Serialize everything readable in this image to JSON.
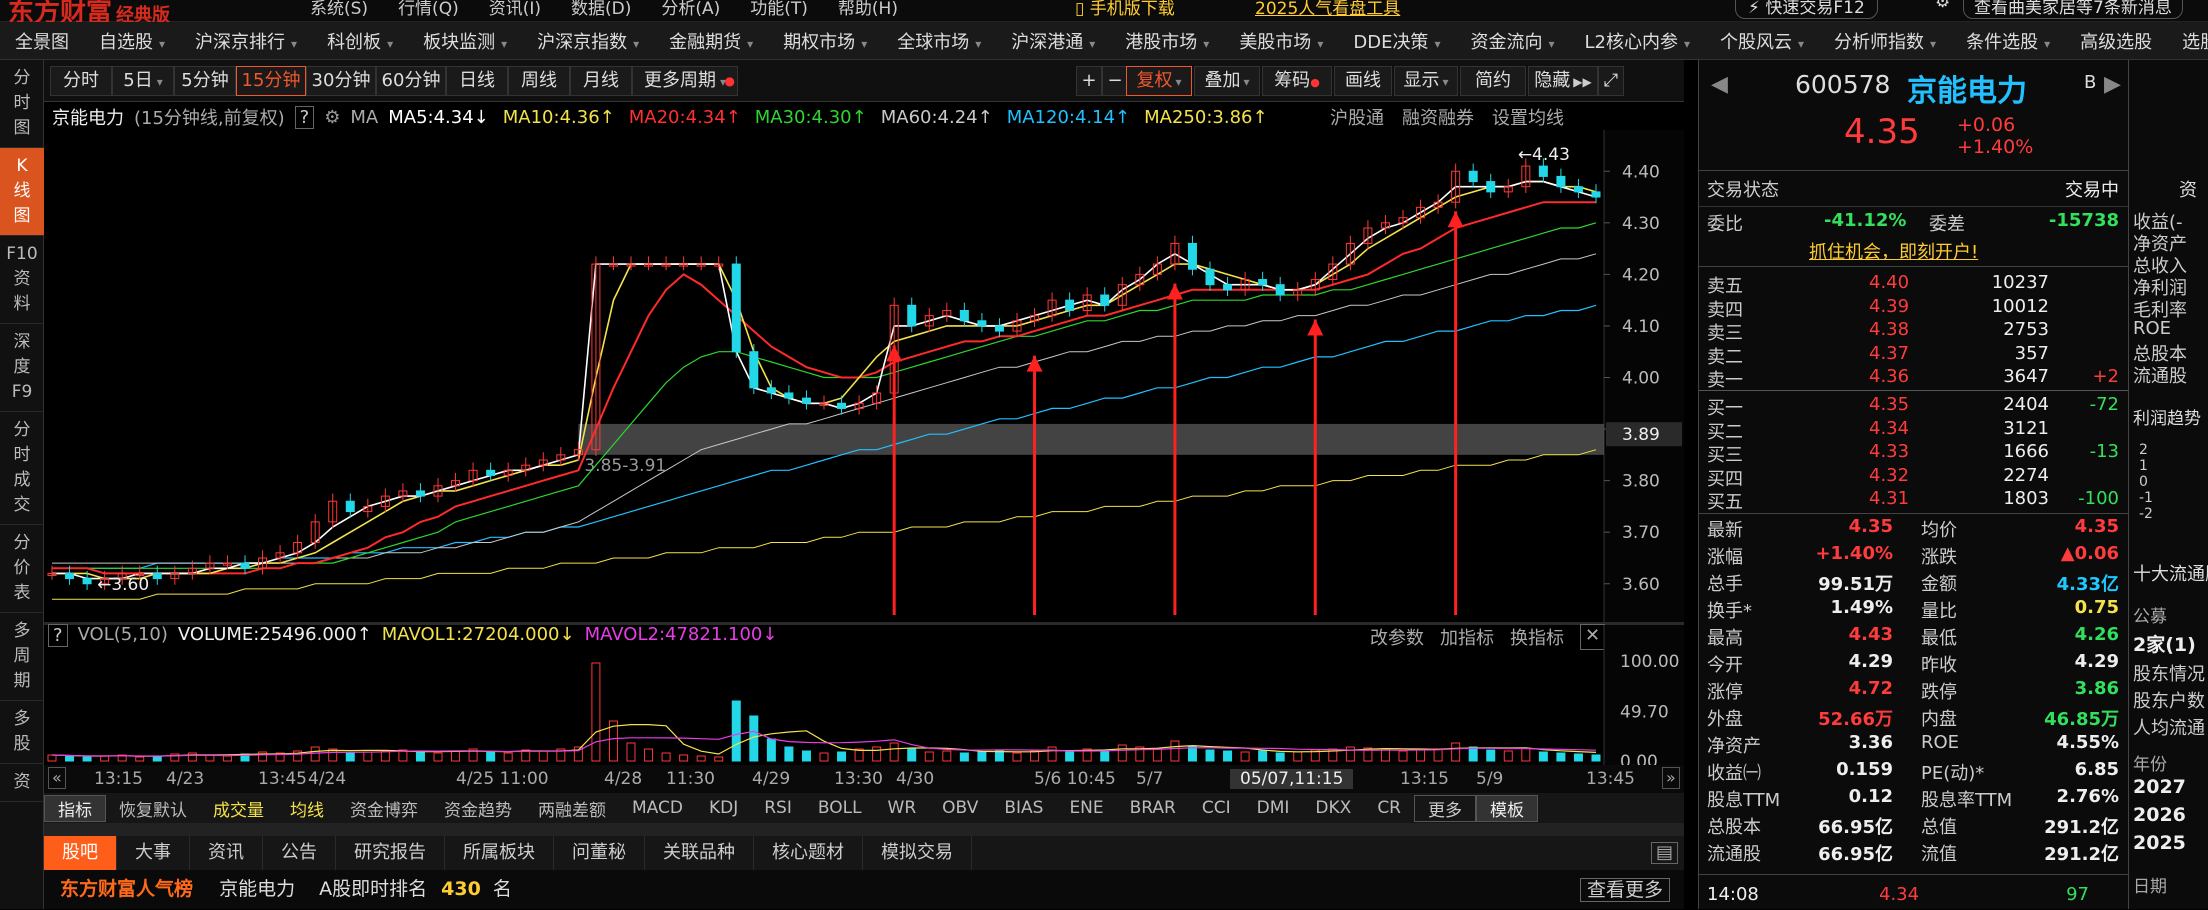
{
  "top": {
    "logo": "东方财富",
    "edition": "经典版",
    "menus": [
      "系统(S)",
      "行情(Q)",
      "资讯(I)",
      "数据(D)",
      "分析(A)",
      "功能(T)",
      "帮助(H)"
    ],
    "mobile": "手机版下载",
    "promo": "2025人气看盘工具",
    "quick_trade": "快速交易F12",
    "notice": "查看曲美家居等7条新消息"
  },
  "nav": [
    "全景图",
    "自选股",
    "沪深京排行",
    "科创板",
    "板块监测",
    "沪深京指数",
    "金融期货",
    "期权市场",
    "全球市场",
    "沪深港通",
    "港股市场",
    "美股市场",
    "DDE决策",
    "资金流向",
    "L2核心内参",
    "个股风云",
    "分析师指数",
    "条件选股",
    "高级选股",
    "选股器"
  ],
  "left_tabs": [
    {
      "label": "分\n时\n图"
    },
    {
      "label": "K\n线\n图",
      "active": true
    },
    {
      "label": "F10\n资\n料"
    },
    {
      "label": "深\n度\nF9"
    },
    {
      "label": "分\n时\n成\n交"
    },
    {
      "label": "分\n价\n表"
    },
    {
      "label": "多\n周\n期"
    },
    {
      "label": "多\n股"
    },
    {
      "label": "资"
    }
  ],
  "periods": [
    "分时",
    "5日",
    "5分钟",
    "15分钟",
    "30分钟",
    "60分钟",
    "日线",
    "周线",
    "月线",
    "更多周期"
  ],
  "active_period": "15分钟",
  "tools": [
    "+",
    "−",
    "复权",
    "叠加",
    "筹码",
    "画线",
    "显示",
    "简约",
    "隐藏"
  ],
  "chart_header": {
    "name": "京能电力",
    "desc": "(15分钟线,前复权)",
    "help": "?",
    "ma_label": "MA",
    "right_links": [
      "沪股通",
      "融资融券",
      "设置均线"
    ]
  },
  "ma_items": [
    {
      "text": "MA5:4.34",
      "arrow": "↓",
      "color": "#ffffff"
    },
    {
      "text": "MA10:4.36",
      "arrow": "↑",
      "color": "#f3e24a"
    },
    {
      "text": "MA20:4.34",
      "arrow": "↑",
      "color": "#ff3030"
    },
    {
      "text": "MA30:4.30",
      "arrow": "↑",
      "color": "#2fd52f"
    },
    {
      "text": "MA60:4.24",
      "arrow": "↑",
      "color": "#c8c8c8"
    },
    {
      "text": "MA120:4.14",
      "arrow": "↑",
      "color": "#23c0ff"
    },
    {
      "text": "MA250:3.86",
      "arrow": "↑",
      "color": "#f3e24a"
    }
  ],
  "chart_data": {
    "type": "line",
    "y_ticks": [
      "4.40",
      "4.30",
      "4.20",
      "4.10",
      "4.00",
      "3.90",
      "3.80",
      "3.70",
      "3.60"
    ],
    "ylim": [
      3.52,
      4.48
    ],
    "current_price_label": "3.89",
    "high_mark": "4.43",
    "low_mark": "3.60",
    "band_label": "3.85-3.91",
    "band": [
      3.85,
      3.91
    ],
    "dates": [
      "13:15",
      "4/23",
      "13:45",
      "4/24",
      "4/25 11:00",
      "4/28",
      "11:30",
      "4/29",
      "13:30",
      "4/30",
      "5/6 10:45",
      "5/7",
      "05/07,11:15",
      "13:15",
      "5/9",
      "13:45"
    ],
    "close": [
      3.62,
      3.61,
      3.6,
      3.61,
      3.62,
      3.62,
      3.61,
      3.62,
      3.63,
      3.64,
      3.64,
      3.63,
      3.65,
      3.66,
      3.68,
      3.72,
      3.76,
      3.74,
      3.75,
      3.77,
      3.78,
      3.77,
      3.79,
      3.8,
      3.82,
      3.81,
      3.82,
      3.83,
      3.84,
      3.85,
      3.86,
      4.22,
      4.22,
      4.22,
      4.22,
      4.22,
      4.22,
      4.22,
      4.22,
      4.05,
      3.98,
      3.97,
      3.96,
      3.95,
      3.95,
      3.94,
      3.95,
      3.97,
      4.14,
      4.1,
      4.12,
      4.13,
      4.11,
      4.1,
      4.09,
      4.11,
      4.12,
      4.15,
      4.13,
      4.16,
      4.14,
      4.18,
      4.2,
      4.22,
      4.26,
      4.21,
      4.18,
      4.17,
      4.19,
      4.18,
      4.16,
      4.17,
      4.19,
      4.22,
      4.26,
      4.29,
      4.3,
      4.31,
      4.33,
      4.34,
      4.4,
      4.38,
      4.36,
      4.37,
      4.41,
      4.39,
      4.37,
      4.36,
      4.35
    ],
    "ma5": [
      3.62,
      3.62,
      3.61,
      3.61,
      3.61,
      3.62,
      3.62,
      3.62,
      3.62,
      3.63,
      3.63,
      3.64,
      3.64,
      3.65,
      3.66,
      3.68,
      3.71,
      3.73,
      3.75,
      3.76,
      3.77,
      3.77,
      3.78,
      3.79,
      3.8,
      3.81,
      3.82,
      3.82,
      3.83,
      3.84,
      3.85,
      4.22,
      4.22,
      4.22,
      4.22,
      4.22,
      4.22,
      4.22,
      4.22,
      4.05,
      3.98,
      3.97,
      3.96,
      3.95,
      3.95,
      3.94,
      3.95,
      3.97,
      4.1,
      4.1,
      4.11,
      4.12,
      4.11,
      4.1,
      4.1,
      4.11,
      4.12,
      4.13,
      4.14,
      4.15,
      4.14,
      4.17,
      4.19,
      4.22,
      4.24,
      4.22,
      4.2,
      4.18,
      4.18,
      4.18,
      4.17,
      4.17,
      4.18,
      4.21,
      4.24,
      4.27,
      4.29,
      4.3,
      4.32,
      4.34,
      4.37,
      4.37,
      4.37,
      4.37,
      4.38,
      4.38,
      4.37,
      4.36,
      4.35
    ],
    "ma10": [
      3.62,
      3.62,
      3.62,
      3.61,
      3.61,
      3.61,
      3.62,
      3.62,
      3.62,
      3.62,
      3.63,
      3.63,
      3.64,
      3.64,
      3.65,
      3.66,
      3.68,
      3.7,
      3.72,
      3.74,
      3.76,
      3.77,
      3.78,
      3.78,
      3.79,
      3.8,
      3.81,
      3.82,
      3.83,
      3.83,
      3.84,
      4.0,
      4.15,
      4.22,
      4.22,
      4.22,
      4.22,
      4.22,
      4.22,
      4.15,
      4.05,
      3.98,
      3.96,
      3.95,
      3.95,
      3.96,
      4.0,
      4.04,
      4.07,
      4.08,
      4.09,
      4.1,
      4.1,
      4.1,
      4.1,
      4.1,
      4.11,
      4.12,
      4.13,
      4.14,
      4.14,
      4.16,
      4.18,
      4.2,
      4.22,
      4.22,
      4.21,
      4.2,
      4.19,
      4.18,
      4.17,
      4.17,
      4.18,
      4.2,
      4.22,
      4.25,
      4.27,
      4.29,
      4.31,
      4.33,
      4.35,
      4.36,
      4.37,
      4.37,
      4.38,
      4.38,
      4.37,
      4.37,
      4.36
    ],
    "ma20": [
      3.63,
      3.63,
      3.63,
      3.62,
      3.62,
      3.62,
      3.62,
      3.62,
      3.62,
      3.62,
      3.62,
      3.62,
      3.63,
      3.63,
      3.64,
      3.64,
      3.65,
      3.66,
      3.67,
      3.69,
      3.7,
      3.72,
      3.73,
      3.75,
      3.76,
      3.77,
      3.78,
      3.79,
      3.8,
      3.81,
      3.82,
      3.9,
      3.98,
      4.05,
      4.12,
      4.17,
      4.2,
      4.18,
      4.15,
      4.12,
      4.09,
      4.06,
      4.04,
      4.02,
      4.01,
      4.0,
      4.0,
      4.01,
      4.03,
      4.04,
      4.05,
      4.06,
      4.07,
      4.07,
      4.08,
      4.08,
      4.09,
      4.1,
      4.11,
      4.12,
      4.12,
      4.13,
      4.14,
      4.15,
      4.16,
      4.17,
      4.17,
      4.17,
      4.17,
      4.17,
      4.17,
      4.17,
      4.17,
      4.18,
      4.19,
      4.2,
      4.22,
      4.24,
      4.25,
      4.27,
      4.29,
      4.3,
      4.31,
      4.32,
      4.33,
      4.34,
      4.34,
      4.34,
      4.34
    ],
    "ma30": [
      3.63,
      3.63,
      3.63,
      3.63,
      3.63,
      3.63,
      3.63,
      3.63,
      3.63,
      3.63,
      3.63,
      3.63,
      3.63,
      3.63,
      3.64,
      3.64,
      3.64,
      3.65,
      3.66,
      3.67,
      3.68,
      3.69,
      3.7,
      3.72,
      3.73,
      3.74,
      3.75,
      3.76,
      3.77,
      3.78,
      3.79,
      3.83,
      3.87,
      3.91,
      3.95,
      3.99,
      4.02,
      4.04,
      4.05,
      4.05,
      4.04,
      4.03,
      4.02,
      4.01,
      4.0,
      4.0,
      4.0,
      4.0,
      4.01,
      4.02,
      4.03,
      4.04,
      4.05,
      4.06,
      4.07,
      4.08,
      4.08,
      4.09,
      4.1,
      4.11,
      4.11,
      4.12,
      4.13,
      4.13,
      4.14,
      4.15,
      4.15,
      4.15,
      4.15,
      4.16,
      4.16,
      4.16,
      4.16,
      4.17,
      4.17,
      4.18,
      4.19,
      4.2,
      4.21,
      4.22,
      4.23,
      4.24,
      4.25,
      4.26,
      4.27,
      4.28,
      4.29,
      4.29,
      4.3
    ],
    "ma60": [
      3.64,
      3.64,
      3.64,
      3.64,
      3.64,
      3.64,
      3.64,
      3.64,
      3.64,
      3.64,
      3.64,
      3.64,
      3.64,
      3.64,
      3.64,
      3.64,
      3.65,
      3.65,
      3.65,
      3.66,
      3.66,
      3.66,
      3.67,
      3.67,
      3.68,
      3.68,
      3.69,
      3.7,
      3.7,
      3.71,
      3.72,
      3.74,
      3.76,
      3.78,
      3.8,
      3.82,
      3.84,
      3.86,
      3.87,
      3.88,
      3.89,
      3.9,
      3.91,
      3.91,
      3.92,
      3.93,
      3.94,
      3.95,
      3.96,
      3.97,
      3.98,
      3.99,
      4.0,
      4.01,
      4.02,
      4.02,
      4.03,
      4.04,
      4.05,
      4.05,
      4.06,
      4.07,
      4.07,
      4.08,
      4.08,
      4.09,
      4.09,
      4.1,
      4.1,
      4.11,
      4.11,
      4.12,
      4.12,
      4.13,
      4.14,
      4.14,
      4.15,
      4.16,
      4.16,
      4.17,
      4.18,
      4.19,
      4.2,
      4.2,
      4.21,
      4.22,
      4.23,
      4.23,
      4.24
    ],
    "ma120": [
      3.63,
      3.63,
      3.63,
      3.63,
      3.63,
      3.63,
      3.64,
      3.64,
      3.64,
      3.64,
      3.64,
      3.64,
      3.64,
      3.65,
      3.65,
      3.65,
      3.65,
      3.66,
      3.66,
      3.66,
      3.67,
      3.67,
      3.67,
      3.68,
      3.68,
      3.69,
      3.69,
      3.7,
      3.7,
      3.71,
      3.71,
      3.72,
      3.73,
      3.74,
      3.75,
      3.76,
      3.77,
      3.78,
      3.79,
      3.8,
      3.81,
      3.82,
      3.82,
      3.83,
      3.84,
      3.85,
      3.86,
      3.86,
      3.87,
      3.88,
      3.89,
      3.89,
      3.9,
      3.91,
      3.92,
      3.92,
      3.93,
      3.94,
      3.94,
      3.95,
      3.96,
      3.96,
      3.97,
      3.98,
      3.98,
      3.99,
      4.0,
      4.0,
      4.01,
      4.02,
      4.02,
      4.03,
      4.04,
      4.04,
      4.05,
      4.06,
      4.07,
      4.07,
      4.08,
      4.09,
      4.09,
      4.1,
      4.11,
      4.11,
      4.12,
      4.12,
      4.13,
      4.13,
      4.14
    ],
    "ma250": [
      3.57,
      3.57,
      3.57,
      3.57,
      3.57,
      3.57,
      3.58,
      3.58,
      3.58,
      3.58,
      3.58,
      3.59,
      3.59,
      3.59,
      3.59,
      3.6,
      3.6,
      3.6,
      3.6,
      3.61,
      3.61,
      3.61,
      3.62,
      3.62,
      3.62,
      3.62,
      3.63,
      3.63,
      3.63,
      3.64,
      3.64,
      3.64,
      3.65,
      3.65,
      3.65,
      3.66,
      3.66,
      3.66,
      3.67,
      3.67,
      3.67,
      3.68,
      3.68,
      3.68,
      3.69,
      3.69,
      3.7,
      3.7,
      3.7,
      3.71,
      3.71,
      3.71,
      3.72,
      3.72,
      3.72,
      3.73,
      3.73,
      3.74,
      3.74,
      3.74,
      3.75,
      3.75,
      3.75,
      3.76,
      3.76,
      3.77,
      3.77,
      3.77,
      3.78,
      3.78,
      3.79,
      3.79,
      3.79,
      3.8,
      3.8,
      3.81,
      3.81,
      3.81,
      3.82,
      3.82,
      3.83,
      3.83,
      3.83,
      3.84,
      3.84,
      3.85,
      3.85,
      3.85,
      3.86
    ],
    "arrows_at": [
      48,
      56,
      64,
      72,
      80
    ],
    "vol": [
      6,
      5,
      4,
      5,
      6,
      4,
      5,
      7,
      8,
      6,
      5,
      7,
      9,
      8,
      10,
      14,
      12,
      8,
      9,
      10,
      11,
      9,
      8,
      10,
      12,
      9,
      8,
      11,
      10,
      12,
      14,
      98,
      40,
      18,
      12,
      8,
      6,
      5,
      4,
      60,
      45,
      22,
      14,
      10,
      8,
      9,
      12,
      14,
      18,
      12,
      9,
      10,
      8,
      9,
      11,
      8,
      10,
      14,
      9,
      12,
      10,
      16,
      14,
      12,
      20,
      15,
      11,
      10,
      9,
      10,
      8,
      9,
      11,
      12,
      14,
      13,
      12,
      10,
      11,
      12,
      18,
      14,
      11,
      10,
      13,
      9,
      8,
      7,
      6
    ],
    "vol_axis": [
      "100.00",
      "49.70",
      "0.00"
    ]
  },
  "vol_header": {
    "label": "VOL(5,10)",
    "volume": "VOLUME:25496.000",
    "mavol1": "MAVOL1:27204.000",
    "mavol2": "MAVOL2:47821.100",
    "right_links": [
      "改参数",
      "加指标",
      "换指标"
    ]
  },
  "indicators": [
    "指标",
    "恢复默认",
    "成交量",
    "均线",
    "资金博弈",
    "资金趋势",
    "两融差额",
    "MACD",
    "KDJ",
    "RSI",
    "BOLL",
    "WR",
    "OBV",
    "BIAS",
    "ENE",
    "BRAR",
    "CCI",
    "DMI",
    "DKX",
    "CR",
    "更多",
    "模板"
  ],
  "bottom_tabs": [
    "股吧",
    "大事",
    "资讯",
    "公告",
    "研究报告",
    "所属板块",
    "问董秘",
    "关联品种",
    "核心题材",
    "模拟交易"
  ],
  "bottom_strip": {
    "brand": "东方财富人气榜",
    "stock": "京能电力",
    "rank_label": "A股即时排名",
    "rank": "430",
    "rank_unit": "名",
    "more": "查看更多"
  },
  "quote": {
    "code": "600578",
    "name": "京能电力",
    "price": "4.35",
    "chg": "+0.06",
    "pct": "+1.40%",
    "b": "B",
    "status_label": "交易状态",
    "status": "交易中",
    "weibi_label": "委比",
    "weibi": "-41.12%",
    "weicha_label": "委差",
    "weicha": "-15738",
    "open_account": "抓住机会，即刻开户!"
  },
  "asks": [
    {
      "label": "卖五",
      "price": "4.40",
      "vol": "10237",
      "diff": ""
    },
    {
      "label": "卖四",
      "price": "4.39",
      "vol": "10012",
      "diff": ""
    },
    {
      "label": "卖三",
      "price": "4.38",
      "vol": "2753",
      "diff": ""
    },
    {
      "label": "卖二",
      "price": "4.37",
      "vol": "357",
      "diff": ""
    },
    {
      "label": "卖一",
      "price": "4.36",
      "vol": "3647",
      "diff": "+2"
    }
  ],
  "bids": [
    {
      "label": "买一",
      "price": "4.35",
      "vol": "2404",
      "diff": "-72"
    },
    {
      "label": "买二",
      "price": "4.34",
      "vol": "3121",
      "diff": ""
    },
    {
      "label": "买三",
      "price": "4.33",
      "vol": "1666",
      "diff": "-13"
    },
    {
      "label": "买四",
      "price": "4.32",
      "vol": "2274",
      "diff": ""
    },
    {
      "label": "买五",
      "price": "4.31",
      "vol": "1803",
      "diff": "-100"
    }
  ],
  "stats": [
    [
      {
        "l": "最新",
        "v": "4.35",
        "c": "red"
      },
      {
        "l": "均价",
        "v": "4.35",
        "c": "red"
      }
    ],
    [
      {
        "l": "涨幅",
        "v": "+1.40%",
        "c": "red"
      },
      {
        "l": "涨跌",
        "v": "▲0.06",
        "c": "red"
      }
    ],
    [
      {
        "l": "总手",
        "v": "99.51万",
        "c": "white"
      },
      {
        "l": "金额",
        "v": "4.33亿",
        "c": "cyan"
      }
    ],
    [
      {
        "l": "换手*",
        "v": "1.49%",
        "c": "white"
      },
      {
        "l": "量比",
        "v": "0.75",
        "c": "yellow"
      }
    ],
    [
      {
        "l": "最高",
        "v": "4.43",
        "c": "red"
      },
      {
        "l": "最低",
        "v": "4.26",
        "c": "green"
      }
    ],
    [
      {
        "l": "今开",
        "v": "4.29",
        "c": "white"
      },
      {
        "l": "昨收",
        "v": "4.29",
        "c": "white"
      }
    ],
    [
      {
        "l": "涨停",
        "v": "4.72",
        "c": "red"
      },
      {
        "l": "跌停",
        "v": "3.86",
        "c": "green"
      }
    ],
    [
      {
        "l": "外盘",
        "v": "52.66万",
        "c": "red"
      },
      {
        "l": "内盘",
        "v": "46.85万",
        "c": "green"
      }
    ],
    [
      {
        "l": "净资产",
        "v": "3.36",
        "c": "white"
      },
      {
        "l": "ROE",
        "v": "4.55%",
        "c": "white"
      }
    ],
    [
      {
        "l": "收益㈠",
        "v": "0.159",
        "c": "white"
      },
      {
        "l": "PE(动)*",
        "v": "6.85",
        "c": "white"
      }
    ],
    [
      {
        "l": "股息TTM",
        "v": "0.12",
        "c": "white"
      },
      {
        "l": "股息率TTM",
        "v": "2.76%",
        "c": "white"
      }
    ],
    [
      {
        "l": "总股本",
        "v": "66.95亿",
        "c": "white"
      },
      {
        "l": "总值",
        "v": "291.2亿",
        "c": "white"
      }
    ],
    [
      {
        "l": "流通股",
        "v": "66.95亿",
        "c": "white"
      },
      {
        "l": "流值",
        "v": "291.2亿",
        "c": "white"
      }
    ]
  ],
  "tick": {
    "time": "14:08",
    "price": "4.34",
    "vol": "97"
  },
  "far_panel": {
    "head": "资",
    "items": [
      "收益(-",
      "净资产",
      "总收入",
      "净利润",
      "毛利率",
      "ROE",
      "总股本",
      "流通股"
    ],
    "profit": "利润趋势",
    "axis": [
      "2",
      "1",
      "0",
      "-1",
      "-2"
    ],
    "top10": "十大流通股",
    "gonggao": "公募",
    "jia": "2家(1)",
    "gd": [
      "股东情况",
      "股东户数",
      "人均流通"
    ],
    "years_label": "年份",
    "years": [
      "2027",
      "2026",
      "2025"
    ],
    "date": "日期"
  }
}
